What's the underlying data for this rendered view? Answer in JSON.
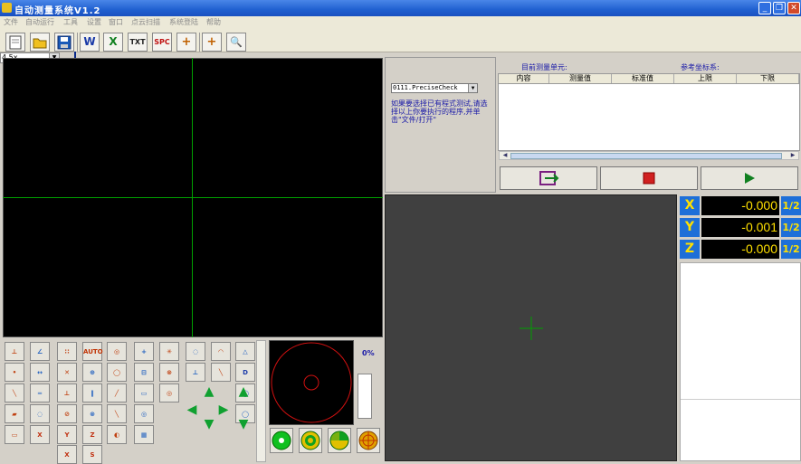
{
  "window": {
    "title": "自动测量系统V1.2",
    "min": "_",
    "max": "❐",
    "close": "✕"
  },
  "menu": [
    "文件",
    "自动运行",
    "工具",
    "设置",
    "窗口",
    "点云扫描",
    "系统登陆",
    "帮助"
  ],
  "toolbar": {
    "new": "",
    "open": "",
    "save": "",
    "word": "W",
    "excel": "X",
    "txt": "TXT",
    "spc": "SPC",
    "add": "+",
    "add2": "+",
    "zoom": "🔍"
  },
  "zoom": {
    "value": "4.5x",
    "arrow": "▼"
  },
  "program": {
    "selected": "0111.PreciseCheck",
    "arrow": "▼",
    "hint": "如果要选择已有程式测试,请选择以上你要执行的程序,并单击\"文件/打开\""
  },
  "results": {
    "current_unit_label": "目前测量单元:",
    "coord_system_label": "参考坐标系:",
    "columns": [
      "内容",
      "测量值",
      "标准值",
      "上限",
      "下限"
    ],
    "scroll_left": "◀",
    "scroll_right": "▶"
  },
  "coords": {
    "x": {
      "label": "X",
      "value": "-0.000",
      "half": "1/2"
    },
    "y": {
      "label": "Y",
      "value": "-0.001",
      "half": "1/2"
    },
    "z": {
      "label": "Z",
      "value": "-0.000",
      "half": "1/2"
    }
  },
  "progress": {
    "label": "0%",
    "value": 0
  },
  "tool_labels": {
    "auto": "AUTO",
    "x": "X",
    "y": "Y",
    "z": "Z",
    "d": "D",
    "s": "S"
  },
  "colors": {
    "accent": "#1e6fd8",
    "crosshair": "#00a000",
    "readout": "#ffe000"
  }
}
